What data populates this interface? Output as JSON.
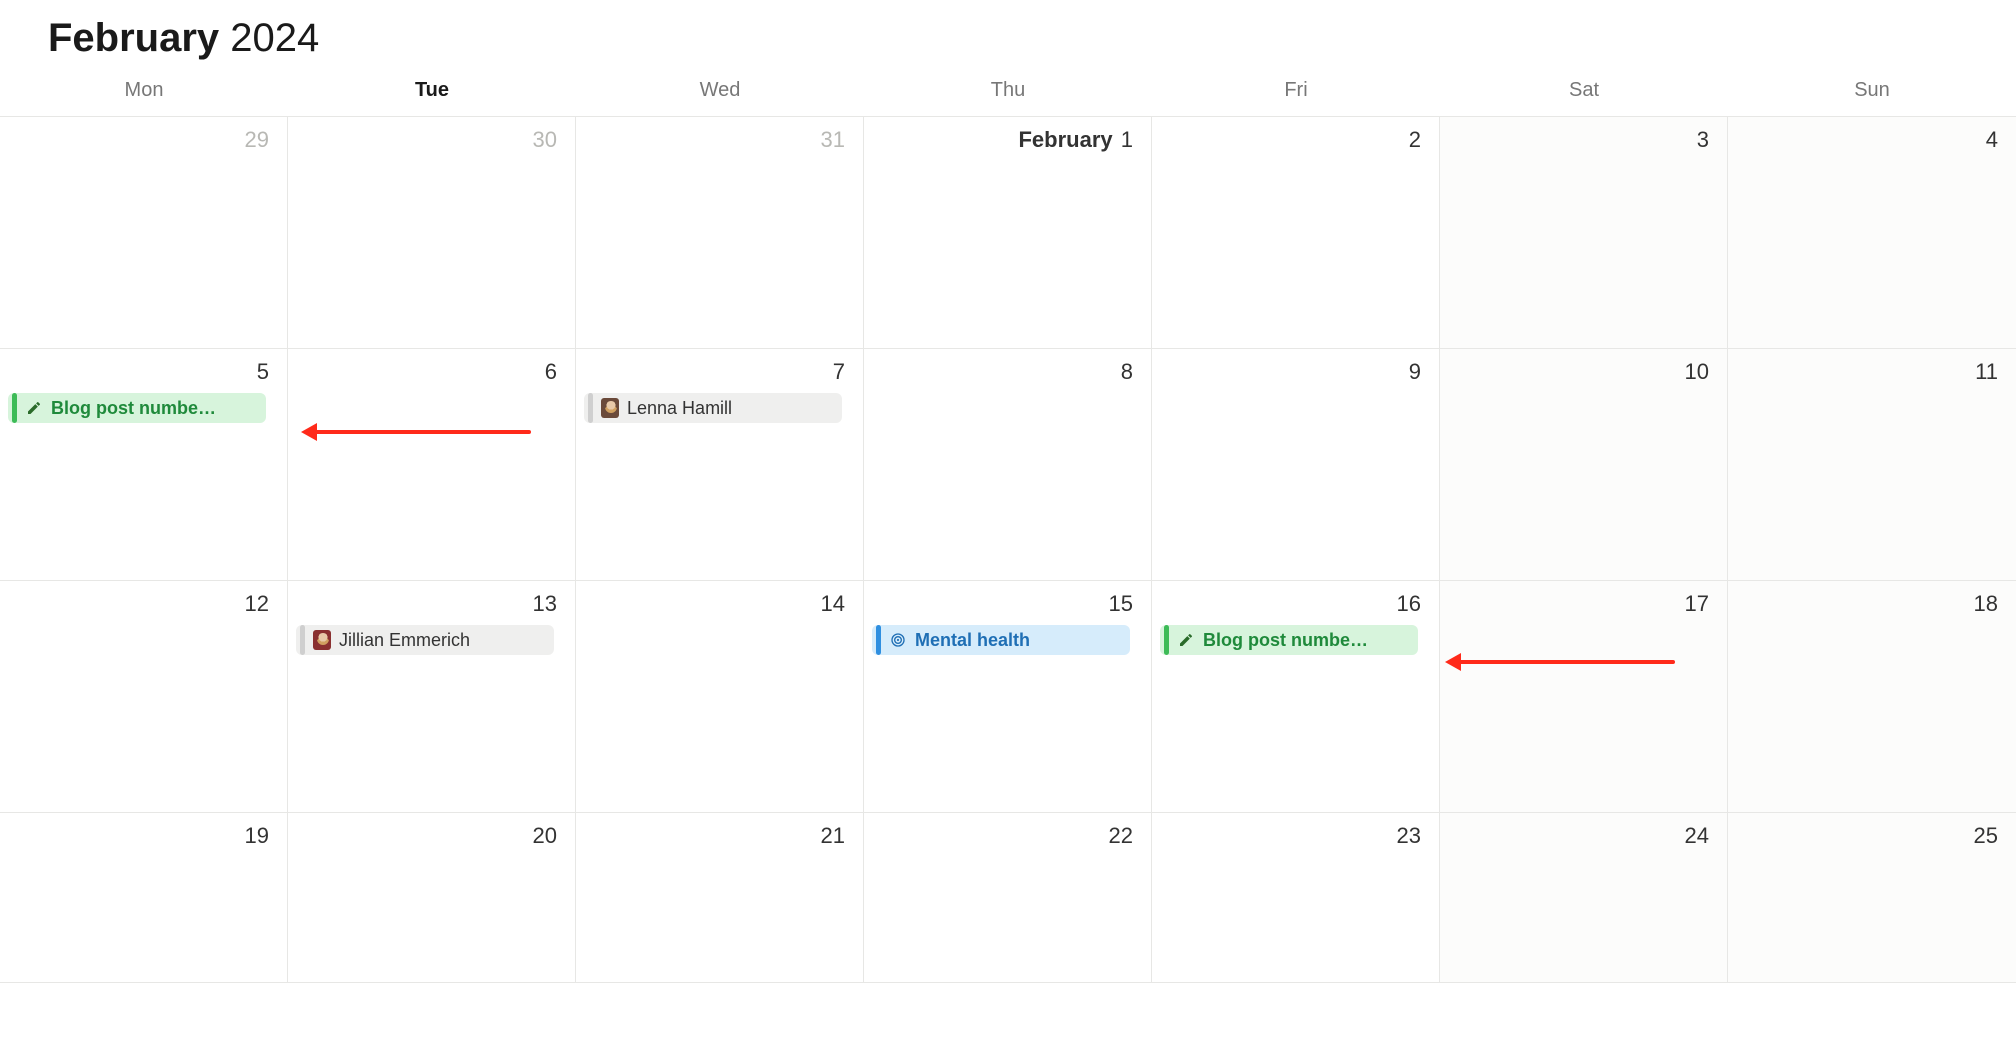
{
  "title": {
    "month": "February",
    "year": "2024"
  },
  "dow": [
    "Mon",
    "Tue",
    "Wed",
    "Thu",
    "Fri",
    "Sat",
    "Sun"
  ],
  "today_col": 1,
  "weeks": [
    {
      "days": [
        {
          "num": "29",
          "other": true
        },
        {
          "num": "30",
          "other": true
        },
        {
          "num": "31",
          "other": true
        },
        {
          "num": "1",
          "month_label": "February"
        },
        {
          "num": "2"
        },
        {
          "num": "3",
          "shaded": true
        },
        {
          "num": "4",
          "shaded": true
        }
      ]
    },
    {
      "days": [
        {
          "num": "5",
          "events": [
            {
              "kind": "green",
              "icon": "pencil",
              "label": "Blog post numbe…"
            }
          ]
        },
        {
          "num": "6"
        },
        {
          "num": "7",
          "events": [
            {
              "kind": "grey",
              "icon": "avatar-a",
              "label": "Lenna Hamill"
            }
          ]
        },
        {
          "num": "8"
        },
        {
          "num": "9"
        },
        {
          "num": "10",
          "shaded": true
        },
        {
          "num": "11",
          "shaded": true
        }
      ]
    },
    {
      "days": [
        {
          "num": "12"
        },
        {
          "num": "13",
          "events": [
            {
              "kind": "grey",
              "icon": "avatar-b",
              "label": "Jillian Emmerich"
            }
          ]
        },
        {
          "num": "14"
        },
        {
          "num": "15",
          "events": [
            {
              "kind": "blue",
              "icon": "target",
              "label": "Mental health"
            }
          ]
        },
        {
          "num": "16",
          "events": [
            {
              "kind": "green",
              "icon": "pencil",
              "label": "Blog post numbe…"
            }
          ]
        },
        {
          "num": "17",
          "shaded": true
        },
        {
          "num": "18",
          "shaded": true
        }
      ]
    },
    {
      "days": [
        {
          "num": "19"
        },
        {
          "num": "20"
        },
        {
          "num": "21"
        },
        {
          "num": "22"
        },
        {
          "num": "23"
        },
        {
          "num": "24",
          "shaded": true
        },
        {
          "num": "25",
          "shaded": true
        }
      ],
      "short": true
    }
  ],
  "annotations": {
    "arrow1": true,
    "arrow2": true
  }
}
